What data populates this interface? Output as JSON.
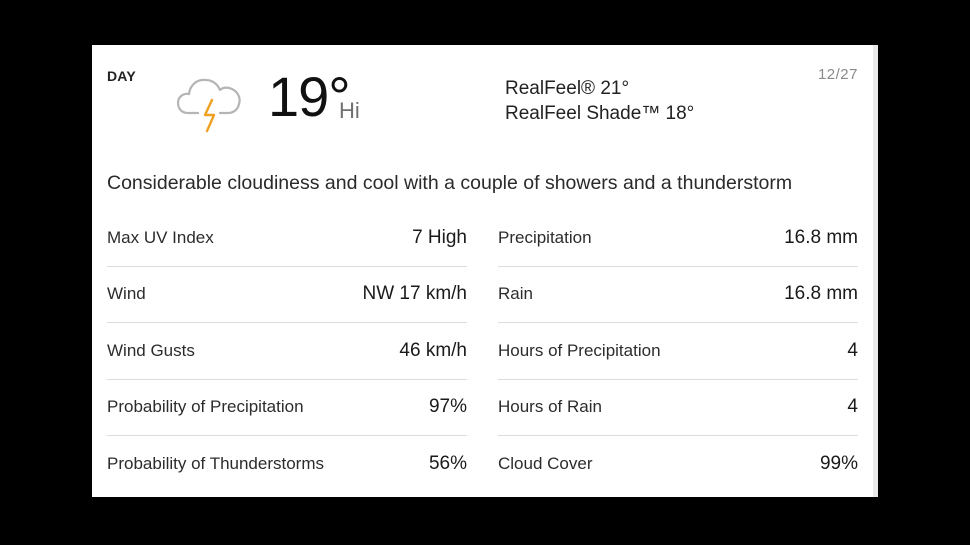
{
  "forecast": {
    "period_label": "DAY",
    "icon": "thunderstorm-cloud-icon",
    "temperature": "19°",
    "temperature_suffix": "Hi",
    "realfeel": "RealFeel® 21°",
    "realfeel_shade": "RealFeel Shade™ 18°",
    "date": "12/27",
    "phrase": "Considerable cloudiness and cool with a couple of showers and a thunderstorm",
    "colors": {
      "cloud": "#b5b5b5",
      "lightning": "#f0a020"
    }
  },
  "details": {
    "left": [
      {
        "label": "Max UV Index",
        "value": "7 High"
      },
      {
        "label": "Wind",
        "value": "NW 17 km/h"
      },
      {
        "label": "Wind Gusts",
        "value": "46 km/h"
      },
      {
        "label": "Probability of Precipitation",
        "value": "97%"
      },
      {
        "label": "Probability of Thunderstorms",
        "value": "56%"
      }
    ],
    "right": [
      {
        "label": "Precipitation",
        "value": "16.8 mm"
      },
      {
        "label": "Rain",
        "value": "16.8 mm"
      },
      {
        "label": "Hours of Precipitation",
        "value": "4"
      },
      {
        "label": "Hours of Rain",
        "value": "4"
      },
      {
        "label": "Cloud Cover",
        "value": "99%"
      }
    ]
  }
}
